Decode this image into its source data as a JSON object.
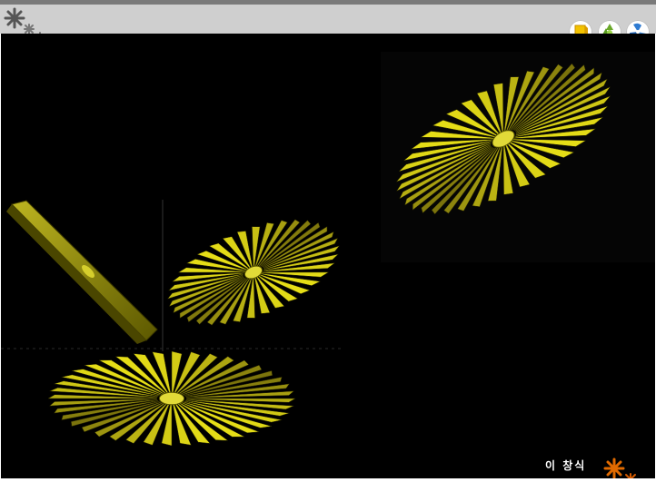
{
  "slide": {
    "author": "이 창식"
  },
  "nav": [
    {
      "name": "nav-button-pen",
      "icon": "pen-icon"
    },
    {
      "name": "nav-button-recycle",
      "icon": "recycle-icon"
    },
    {
      "name": "nav-button-fan",
      "icon": "fan-icon"
    }
  ],
  "colors": {
    "header": "#cfcfcf",
    "stage": "#000000",
    "fin": "#c8c020",
    "accent_orange": "#e06a00"
  }
}
